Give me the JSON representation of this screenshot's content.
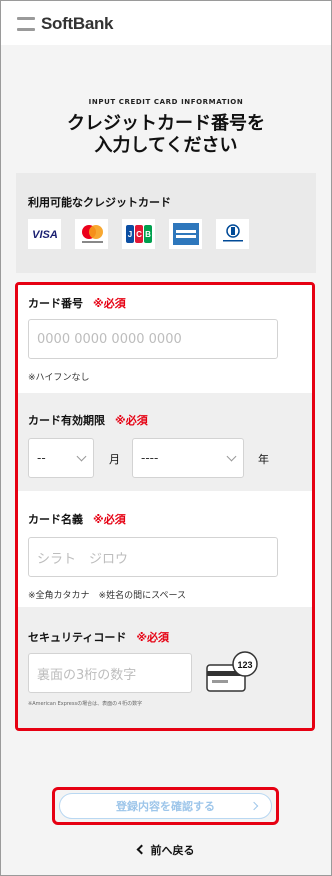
{
  "header": {
    "logo_text": "SoftBank"
  },
  "page": {
    "eyebrow": "INPUT CREDIT CARD INFORMATION",
    "title_line1": "クレジットカード番号を",
    "title_line2": "入力してください"
  },
  "brands": {
    "label": "利用可能なクレジットカード",
    "items": [
      "VISA",
      "mastercard",
      "JCB",
      "AMERICAN EXPRESS",
      "Diners Club INTERNATIONAL"
    ]
  },
  "form": {
    "required_mark": "※必須",
    "card_number": {
      "label": "カード番号",
      "placeholder": "0000 0000 0000 0000",
      "note": "※ハイフンなし"
    },
    "expiry": {
      "label": "カード有効期限",
      "month_value": "--",
      "month_unit": "月",
      "year_value": "----",
      "year_unit": "年"
    },
    "card_name": {
      "label": "カード名義",
      "placeholder": "シラト　ジロウ",
      "note": "※全角カタカナ　※姓名の間にスペース"
    },
    "security": {
      "label": "セキュリティコード",
      "placeholder": "裏面の3桁の数字",
      "note": "※American Expressの場合は、表面の４桁の数字",
      "illustration_number": "123"
    }
  },
  "actions": {
    "confirm_label": "登録内容を確認する",
    "back_label": "前へ戻る"
  },
  "colors": {
    "accent_red": "#e60012",
    "button_blue": "#9ec6ea"
  }
}
